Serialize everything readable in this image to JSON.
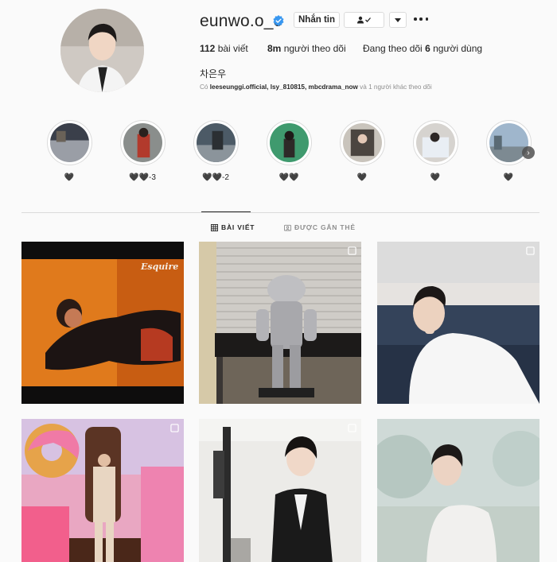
{
  "profile": {
    "username": "eunwo.o_c",
    "verified": true,
    "verified_color": "#3897f0",
    "full_name": "차은우",
    "followed_by_prefix": "Có",
    "followed_by_names": "leeseunggi.official, lsy_810815, mbcdrama_now",
    "followed_by_suffix": "và 1 người khác theo dõi"
  },
  "actions": {
    "message_label": "Nhắn tin",
    "follow_icon": "person-check-icon",
    "more_icon": "chevron-down-icon",
    "options_icon": "more-dots-icon"
  },
  "stats": {
    "posts_count": "112",
    "posts_label": "bài viết",
    "followers_count": "8m",
    "followers_label": "người theo dõi",
    "following_prefix": "Đang theo dõi",
    "following_count": "6",
    "following_suffix": "người dùng"
  },
  "highlights": [
    {
      "label": "🖤"
    },
    {
      "label": "🖤🖤-3"
    },
    {
      "label": "🖤🖤-2"
    },
    {
      "label": "🖤🖤"
    },
    {
      "label": "🖤"
    },
    {
      "label": "🖤"
    },
    {
      "label": "🖤"
    }
  ],
  "tabs": [
    {
      "label": "BÀI VIẾT",
      "icon": "grid-icon",
      "active": true
    },
    {
      "label": "ĐƯỢC GẮN THẺ",
      "icon": "tag-icon",
      "active": false
    }
  ],
  "posts": [
    {
      "magazine_text": "Esquire",
      "multi": false
    },
    {
      "multi": true
    },
    {
      "multi": true
    },
    {
      "multi": true
    },
    {
      "multi": true
    },
    {
      "multi": false
    }
  ]
}
